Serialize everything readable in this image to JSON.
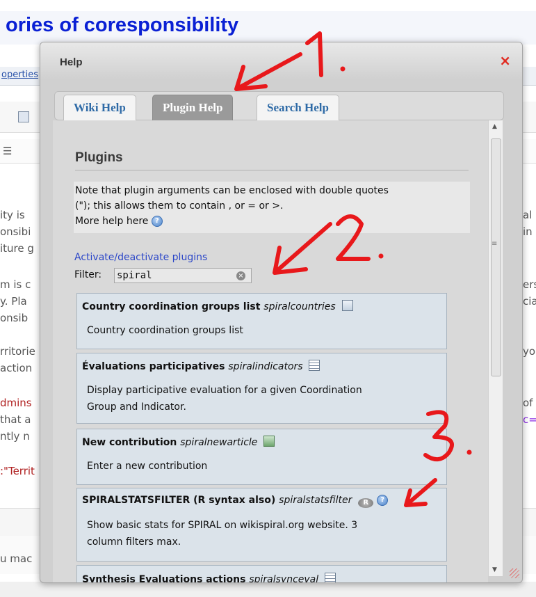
{
  "background": {
    "page_title": "ories of coresponsibility",
    "tab_link": "operties",
    "left_snippets": [
      "ity is",
      "onsibi",
      "iture g",
      "m is c",
      "y. Pla",
      "onsib",
      "rritorie",
      "action",
      "dmins",
      " that a",
      "ntly n",
      ":\"Territ",
      "u mac"
    ],
    "right_snippets": [
      "al",
      "in",
      "ers",
      "cia",
      "yo",
      "of c",
      "c="
    ]
  },
  "dialog": {
    "title": "Help",
    "close": "×",
    "tabs": [
      {
        "label": "Wiki Help",
        "active": false
      },
      {
        "label": "Plugin Help",
        "active": true
      },
      {
        "label": "Search Help",
        "active": false
      }
    ],
    "heading": "Plugins",
    "note_line1": "Note that plugin arguments can be enclosed with double quotes",
    "note_line2": "(\"); this allows them to contain , or = or >.",
    "more_help": "More help here",
    "activate_link": "Activate/deactivate plugins",
    "filter_label": "Filter:",
    "filter_value": "spiral",
    "plugins": [
      {
        "name": "Country coordination groups list",
        "code": "spiralcountries",
        "icon": "table-icon",
        "desc1": "Country coordination groups list",
        "desc2": ""
      },
      {
        "name": "Évaluations participatives",
        "code": "spiralindicators",
        "icon": "calculator-icon",
        "desc1": "Display participative evaluation for a given Coordination",
        "desc2": "Group and Indicator."
      },
      {
        "name": "New contribution",
        "code": "spiralnewarticle",
        "icon": "form-icon",
        "desc1": "Enter a new contribution",
        "desc2": ""
      },
      {
        "name": "SPIRALSTATSFILTER (R syntax also)",
        "code": "spiralstatsfilter",
        "icon": "r-logo-icon",
        "desc1": "Show basic stats for SPIRAL on wikispiral.org website. 3",
        "desc2": "column filters max."
      },
      {
        "name": "Synthesis Evaluations actions",
        "code": "spiralsynceval",
        "icon": "calculator-icon",
        "desc1": "",
        "desc2": ""
      }
    ]
  },
  "annotations": [
    "1.",
    "2.",
    "3."
  ],
  "colors": {
    "accent": "#e0291f",
    "link": "#2b46c8",
    "title": "#0a20d4"
  }
}
